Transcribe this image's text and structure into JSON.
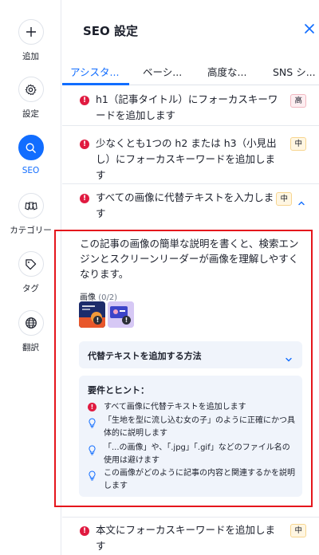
{
  "rail": {
    "items": [
      {
        "label": "追加",
        "icon": "plus-icon"
      },
      {
        "label": "設定",
        "icon": "gear-icon"
      },
      {
        "label": "SEO",
        "icon": "search-icon"
      },
      {
        "label": "カテゴリー",
        "icon": "category-icon"
      },
      {
        "label": "タグ",
        "icon": "tag-icon"
      },
      {
        "label": "翻訳",
        "icon": "globe-icon"
      }
    ]
  },
  "panel": {
    "title": "SEO 設定",
    "tabs": [
      "アシスタ...",
      "ベーシ...",
      "高度な...",
      "SNS シ..."
    ]
  },
  "checks": [
    {
      "text": "h1（記事タイトル）にフォーカスキーワードを追加します",
      "priority": "高"
    },
    {
      "text": "少なくとも1つの h2 または h3（小見出し）にフォーカスキーワードを追加します",
      "priority": "中"
    },
    {
      "text": "すべての画像に代替テキストを入力します",
      "priority": "中"
    },
    {
      "text": "本文にフォーカスキーワードを追加します",
      "priority": "中"
    }
  ],
  "expanded": {
    "description": "この記事の画像の簡単な説明を書くと、検索エンジンとスクリーンリーダーが画像を理解しやすくなります。",
    "images_label": "画像",
    "images_count": "(0/2)",
    "accordion_label": "代替テキストを追加する方法",
    "hints_title": "要件とヒント：",
    "hints": [
      "すべて画像に代替テキストを追加します",
      "「生地を型に流し込む女の子」のように正確にかつ具体的に説明します",
      "「...の画像」や、「.jpg」「.gif」などのファイル名の使用は避けます",
      "この画像がどのように記事の内容と関連するかを説明します"
    ]
  },
  "colors": {
    "accent": "#116dff",
    "error": "#e01a40",
    "highlight": "#e5161c"
  }
}
